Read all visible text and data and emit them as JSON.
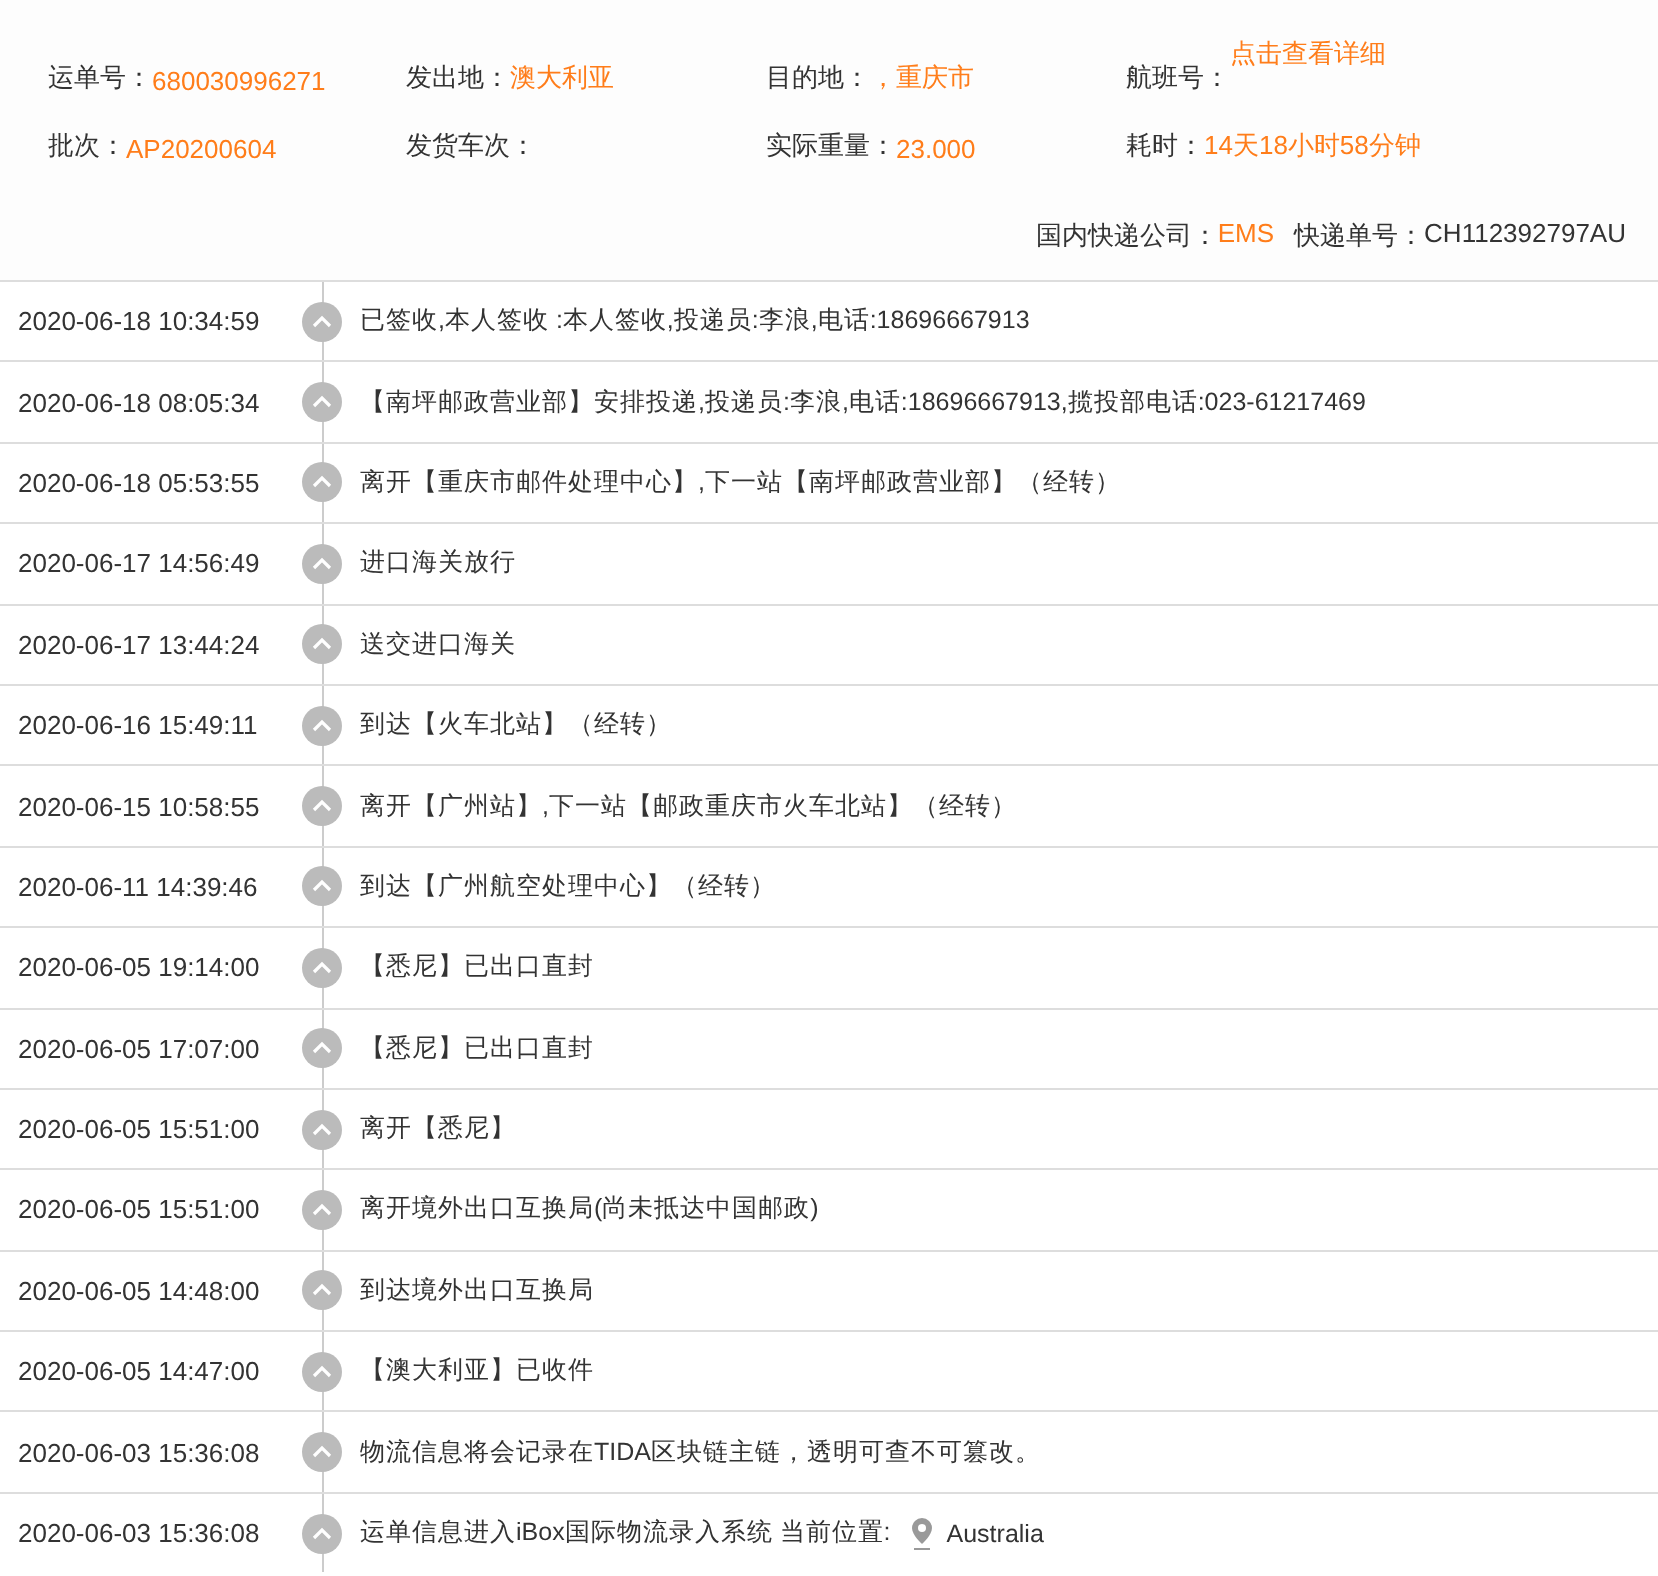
{
  "summary": {
    "fields": [
      {
        "label": "运单号：",
        "value": "680030996271"
      },
      {
        "label": "发出地：",
        "value": "澳大利亚"
      },
      {
        "label": "目的地：",
        "value": "，重庆市"
      },
      {
        "label": "航班号：",
        "value": "点击查看详细",
        "kind": "link"
      },
      {
        "label": "批次：",
        "value": "AP20200604"
      },
      {
        "label": "发货车次："
      },
      {
        "label": "实际重量：",
        "value": "23.000"
      },
      {
        "label": "耗时：",
        "value": "14天18小时58分钟"
      }
    ],
    "courier": {
      "company_label": "国内快递公司：",
      "company": "EMS",
      "number_label": "快递单号：",
      "number": "CH112392797AU"
    }
  },
  "events": [
    {
      "time": "2020-06-18 10:34:59",
      "text": "已签收,本人签收 :本人签收,投递员:李浪,电话:18696667913"
    },
    {
      "time": "2020-06-18 08:05:34",
      "text": "【南坪邮政营业部】安排投递,投递员:李浪,电话:18696667913,揽投部电话:023-61217469"
    },
    {
      "time": "2020-06-18 05:53:55",
      "text": "离开【重庆市邮件处理中心】,下一站【南坪邮政营业部】（经转）"
    },
    {
      "time": "2020-06-17 14:56:49",
      "text": "进口海关放行"
    },
    {
      "time": "2020-06-17 13:44:24",
      "text": "送交进口海关"
    },
    {
      "time": "2020-06-16 15:49:11",
      "text": "到达【火车北站】（经转）"
    },
    {
      "time": "2020-06-15 10:58:55",
      "text": "离开【广州站】,下一站【邮政重庆市火车北站】（经转）"
    },
    {
      "time": "2020-06-11 14:39:46",
      "text": "到达【广州航空处理中心】（经转）"
    },
    {
      "time": "2020-06-05 19:14:00",
      "text": "【悉尼】已出口直封"
    },
    {
      "time": "2020-06-05 17:07:00",
      "text": "【悉尼】已出口直封"
    },
    {
      "time": "2020-06-05 15:51:00",
      "text": "离开【悉尼】"
    },
    {
      "time": "2020-06-05 15:51:00",
      "text": "离开境外出口互换局(尚未抵达中国邮政)"
    },
    {
      "time": "2020-06-05 14:48:00",
      "text": "到达境外出口互换局"
    },
    {
      "time": "2020-06-05 14:47:00",
      "text": "【澳大利亚】已收件"
    },
    {
      "time": "2020-06-03 15:36:08",
      "text": "物流信息将会记录在TIDA区块链主链，透明可查不可篡改。"
    },
    {
      "time": "2020-06-03 15:36:08",
      "text": "运单信息进入iBox国际物流录入系统 当前位置:",
      "location": "Australia"
    }
  ]
}
